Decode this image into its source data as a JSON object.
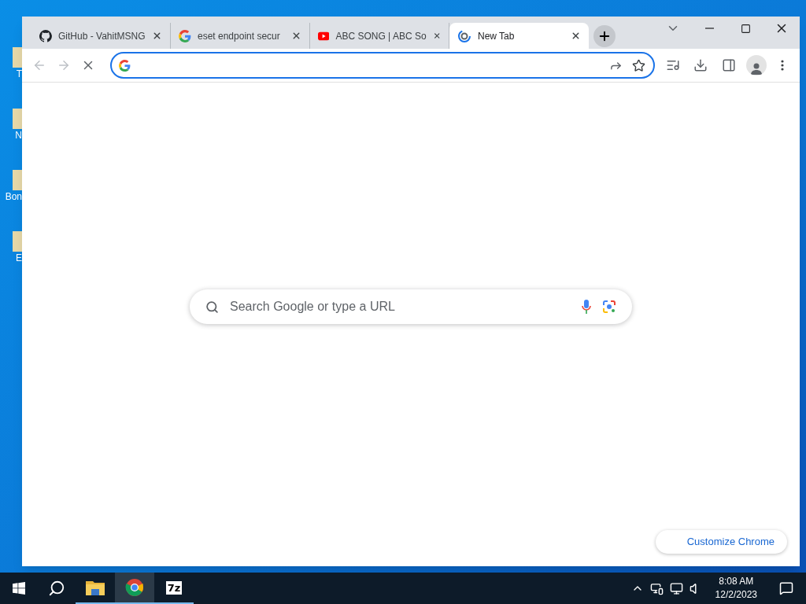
{
  "desktop": {
    "icons": [
      {
        "label": "T"
      },
      {
        "label": "N"
      },
      {
        "label": "Bon"
      },
      {
        "label": "E"
      }
    ]
  },
  "browser": {
    "tabs": [
      {
        "title": "GitHub - VahitMSNG",
        "kind": "github",
        "selected": false
      },
      {
        "title": "eset endpoint secur",
        "kind": "google",
        "selected": false
      },
      {
        "title": "ABC SONG | ABC So",
        "kind": "youtube",
        "selected": false
      },
      {
        "title": "New Tab",
        "kind": "loading",
        "selected": true
      }
    ],
    "loading": true,
    "search_placeholder": "Search Google or type a URL",
    "customize_button": "Customize Chrome"
  },
  "taskbar": {
    "apps": [
      {
        "kind": "explorer",
        "active": false
      },
      {
        "kind": "chrome",
        "active": true
      },
      {
        "kind": "sevenzip",
        "label": "7z",
        "active": false
      }
    ],
    "clock": {
      "time": "8:08 AM",
      "date": "12/2/2023"
    }
  }
}
